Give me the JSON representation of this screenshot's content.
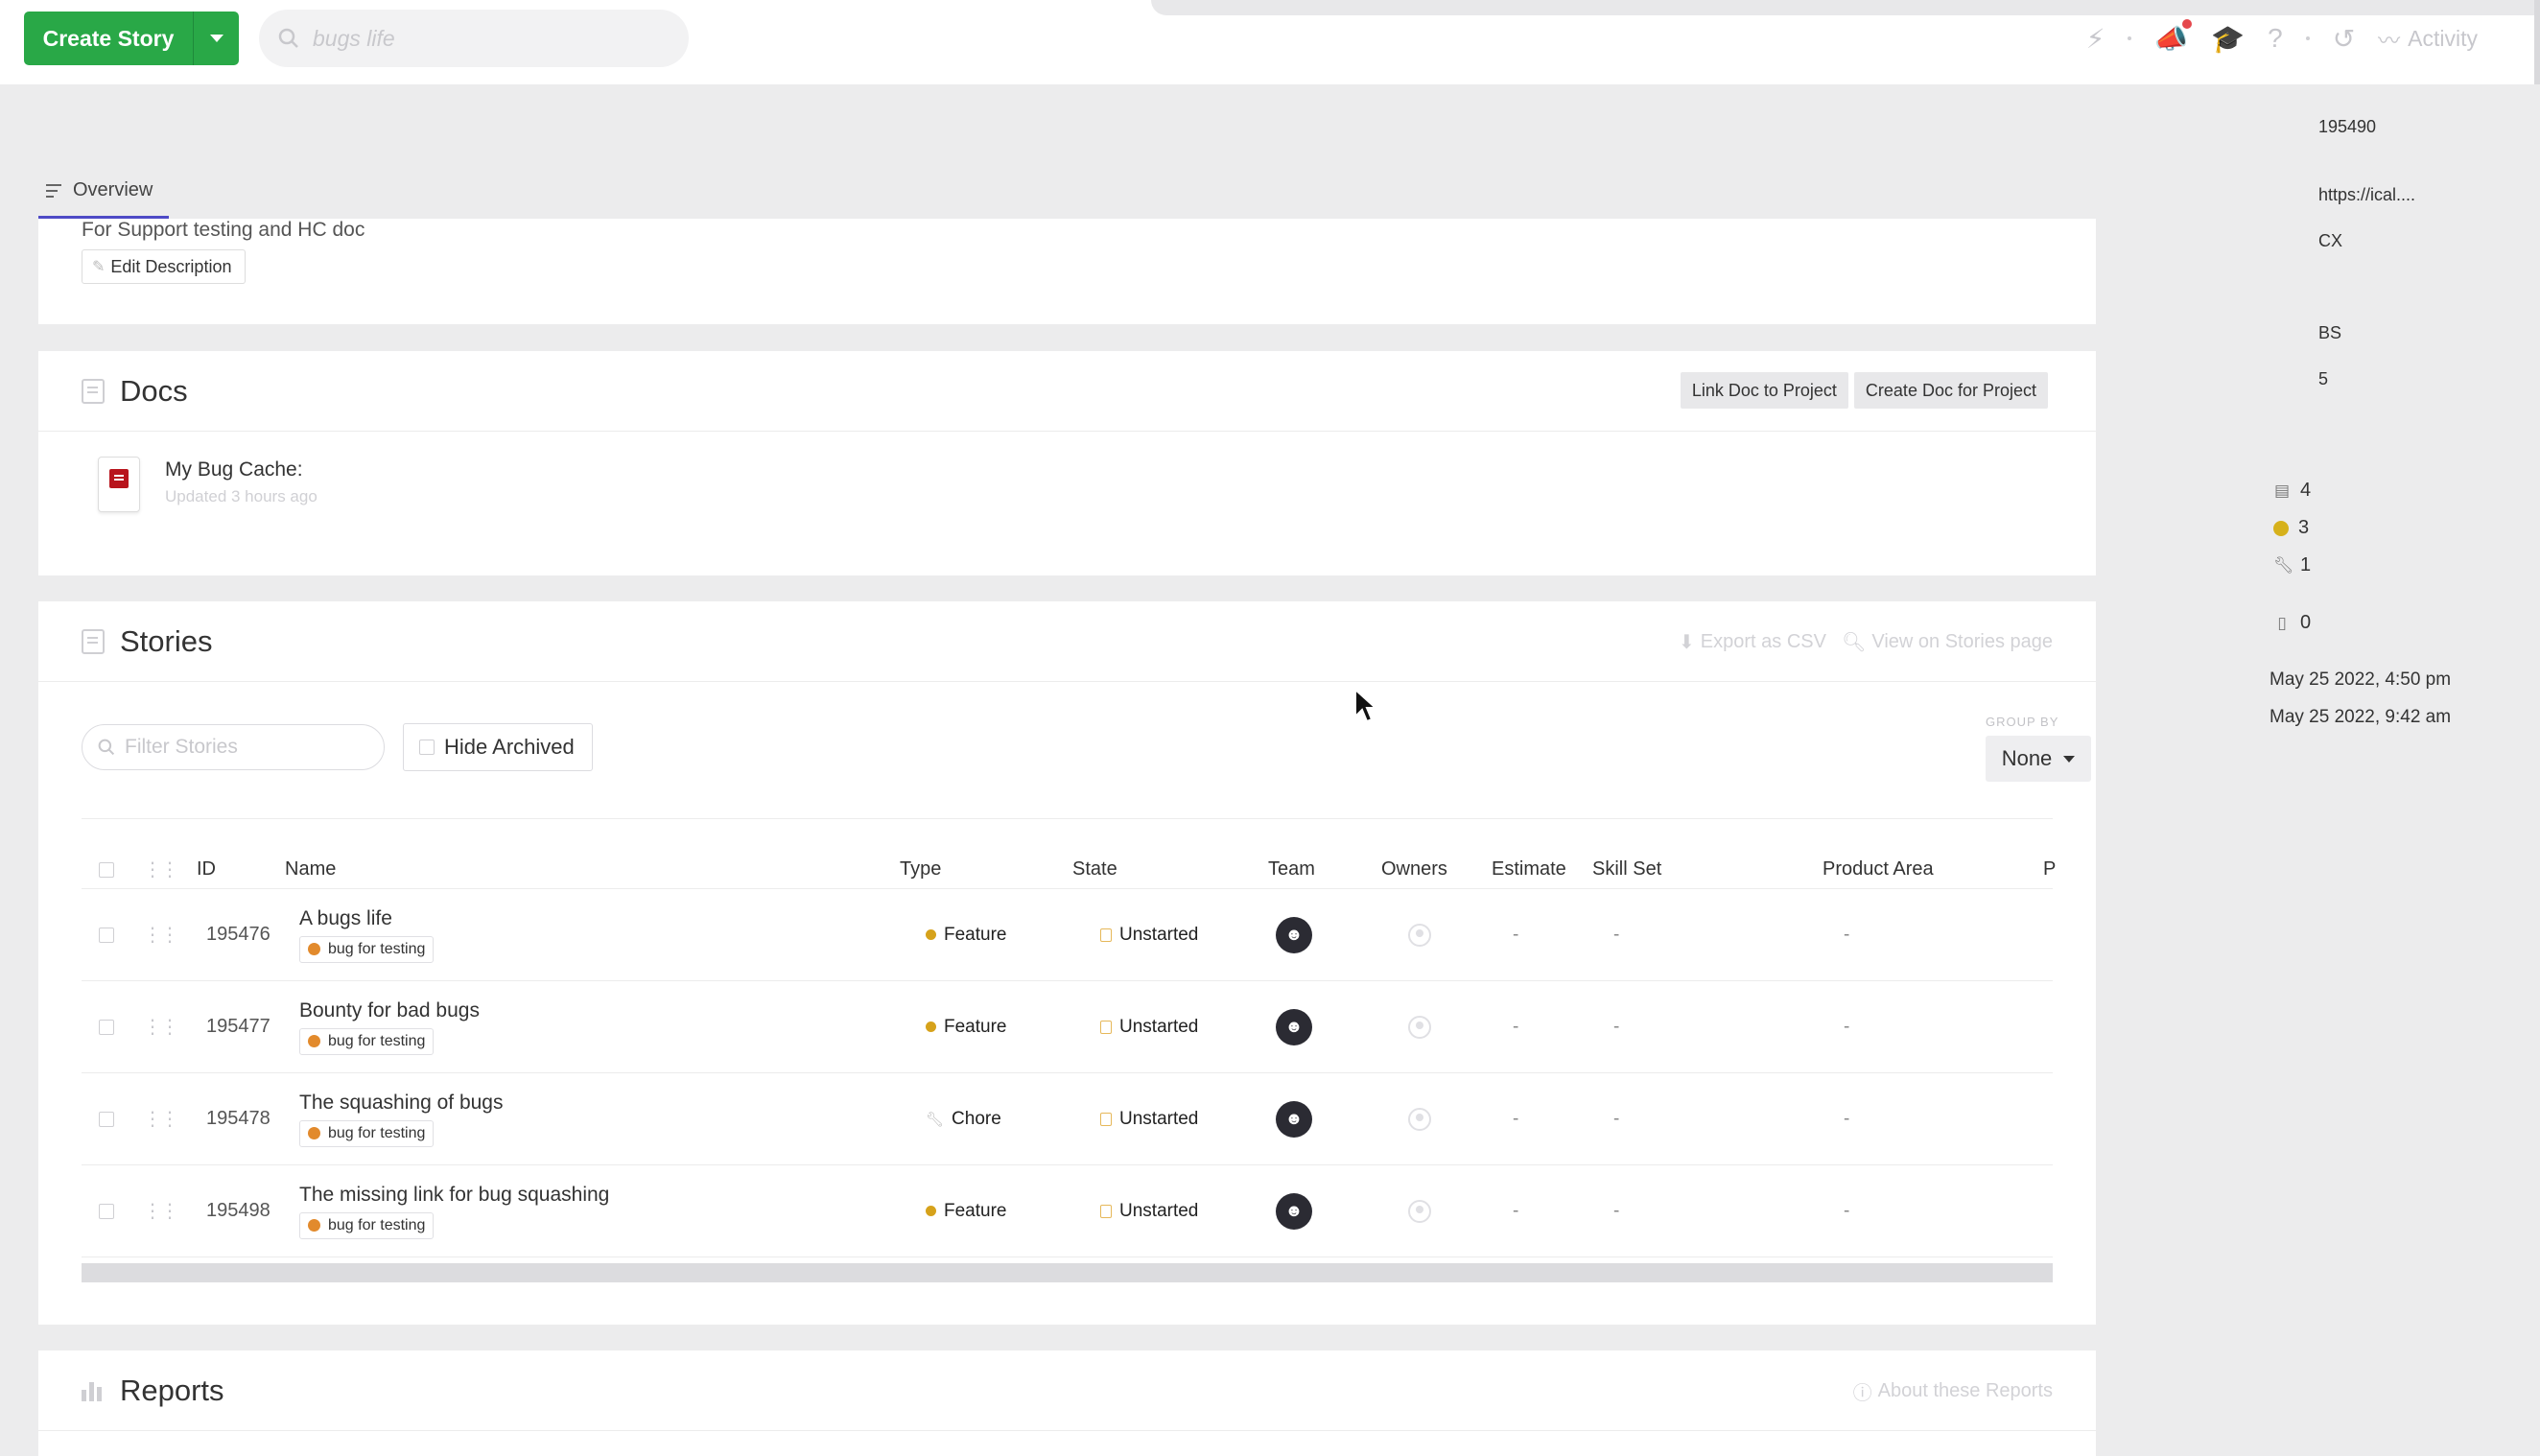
{
  "topbar": {
    "create_story_label": "Create Story",
    "search_placeholder": "bugs life",
    "activity_label": "Activity"
  },
  "tabs": {
    "overview_label": "Overview"
  },
  "description": {
    "text": "For Support testing and HC doc",
    "edit_label": "Edit Description"
  },
  "docs": {
    "title": "Docs",
    "link_btn": "Link Doc to Project",
    "create_btn": "Create Doc for Project",
    "items": [
      {
        "title": "My Bug Cache:",
        "updated": "Updated 3 hours ago"
      }
    ]
  },
  "stories": {
    "title": "Stories",
    "export_label": "Export as CSV",
    "view_label": "View on Stories page",
    "filter_placeholder": "Filter Stories",
    "hide_archived": "Hide Archived",
    "group_by_label": "GROUP BY",
    "group_by_value": "None",
    "columns": {
      "id": "ID",
      "name": "Name",
      "type": "Type",
      "state": "State",
      "team": "Team",
      "owners": "Owners",
      "estimate": "Estimate",
      "skill_set": "Skill Set",
      "product_area": "Product Area",
      "extra": "P"
    },
    "rows": [
      {
        "id": "195476",
        "name": "A bugs life",
        "label": "bug for testing",
        "type": "Feature",
        "state": "Unstarted",
        "estimate": "-",
        "skill_set": "-",
        "product_area": "-"
      },
      {
        "id": "195477",
        "name": "Bounty for bad bugs",
        "label": "bug for testing",
        "type": "Feature",
        "state": "Unstarted",
        "estimate": "-",
        "skill_set": "-",
        "product_area": "-"
      },
      {
        "id": "195478",
        "name": "The squashing of bugs",
        "label": "bug for testing",
        "type": "Chore",
        "state": "Unstarted",
        "estimate": "-",
        "skill_set": "-",
        "product_area": "-"
      },
      {
        "id": "195498",
        "name": "The missing link for bug squashing",
        "label": "bug for testing",
        "type": "Feature",
        "state": "Unstarted",
        "estimate": "-",
        "skill_set": "-",
        "product_area": "-"
      }
    ]
  },
  "reports": {
    "title": "Reports",
    "about_label": "About these Reports"
  },
  "right_panel": {
    "project_id": "195490",
    "calendar_url": "https://ical....",
    "team_abbr": "CX",
    "abbr": "BS",
    "points": "5",
    "stories_count": "4",
    "features_count": "3",
    "chores_count": "1",
    "docs_count": "0",
    "updated_at": "May 25 2022, 4:50 pm",
    "created_at": "May 25 2022, 9:42 am"
  },
  "colors": {
    "brand_green": "#29a847",
    "tab_accent": "#4e4ac6",
    "label_orange": "#e28a2c",
    "feature_yellow": "#d6a21b"
  }
}
